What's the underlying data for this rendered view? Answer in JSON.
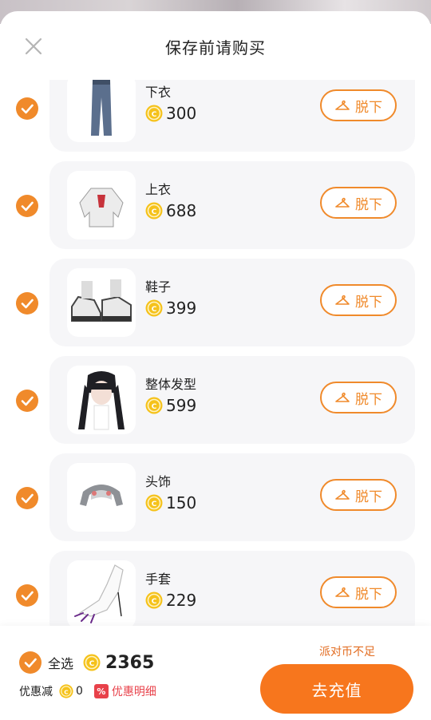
{
  "dialog": {
    "title": "保存前请购买"
  },
  "items": [
    {
      "name": "下衣",
      "price": "300",
      "remove_label": "脱下",
      "thumb": "pants"
    },
    {
      "name": "上衣",
      "price": "688",
      "remove_label": "脱下",
      "thumb": "jacket"
    },
    {
      "name": "鞋子",
      "price": "399",
      "remove_label": "脱下",
      "thumb": "shoes"
    },
    {
      "name": "整体发型",
      "price": "599",
      "remove_label": "脱下",
      "thumb": "hair"
    },
    {
      "name": "头饰",
      "price": "150",
      "remove_label": "脱下",
      "thumb": "headwear"
    },
    {
      "name": "手套",
      "price": "229",
      "remove_label": "脱下",
      "thumb": "glove"
    }
  ],
  "footer": {
    "select_all_label": "全选",
    "total": "2365",
    "discount_label": "优惠减",
    "discount_value": "0",
    "discount_badge": "%",
    "discount_detail_label": "优惠明细",
    "insufficient_text": "派对币不足",
    "recharge_label": "去充值"
  },
  "colors": {
    "accent": "#f7761d",
    "check": "#f08a2b",
    "coin": "#f5c21b",
    "discount": "#e8414a"
  }
}
